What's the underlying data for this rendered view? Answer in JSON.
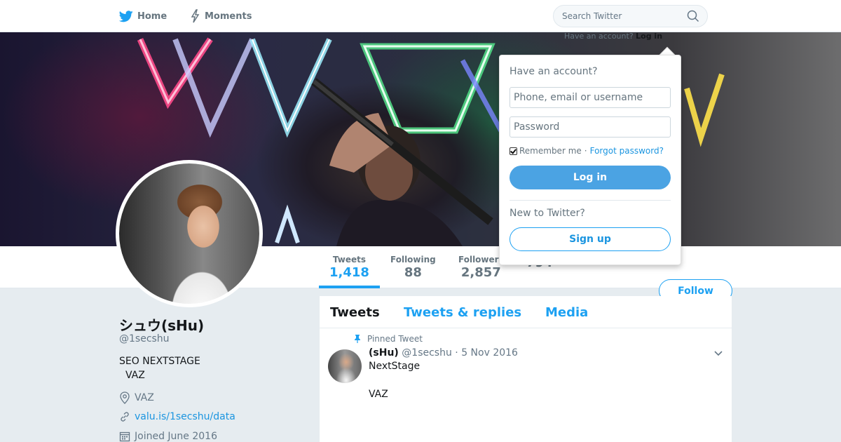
{
  "nav": {
    "home_label": "Home",
    "moments_label": "Moments",
    "search_placeholder": "Search Twitter",
    "have_account_prefix": "Have an account?",
    "login_link": "Log in"
  },
  "profile": {
    "name": "シュウ(sHu)",
    "handle": "@1secshu",
    "bio_line1": "SEO NEXTSTAGE",
    "bio_line2": "VAZ",
    "location": "VAZ",
    "url": "valu.is/1secshu/data",
    "joined": "Joined June 2016",
    "follow_label": "Follow"
  },
  "stats": [
    {
      "label": "Tweets",
      "value": "1,418"
    },
    {
      "label": "Following",
      "value": "88"
    },
    {
      "label": "Followers",
      "value": "2,857"
    },
    {
      "label": "",
      "value": "794"
    }
  ],
  "timeline": {
    "tabs": [
      "Tweets",
      "Tweets & replies",
      "Media"
    ],
    "pinned_label": "Pinned Tweet",
    "tweet": {
      "author": "(sHu)",
      "handle": "@1secshu",
      "date": "5 Nov 2016",
      "line1": "NextStage",
      "line2": "VAZ"
    }
  },
  "login_dropdown": {
    "title": "Have an account?",
    "username_placeholder": "Phone, email or username",
    "password_placeholder": "Password",
    "remember_label": "Remember me",
    "separator": "·",
    "forgot_label": "Forgot password?",
    "login_button": "Log in",
    "new_label": "New to Twitter?",
    "signup_button": "Sign up"
  },
  "colors": {
    "accent": "#1da1f2",
    "login_button": "#4ba3e3",
    "page_bg": "#e6ecf0"
  }
}
